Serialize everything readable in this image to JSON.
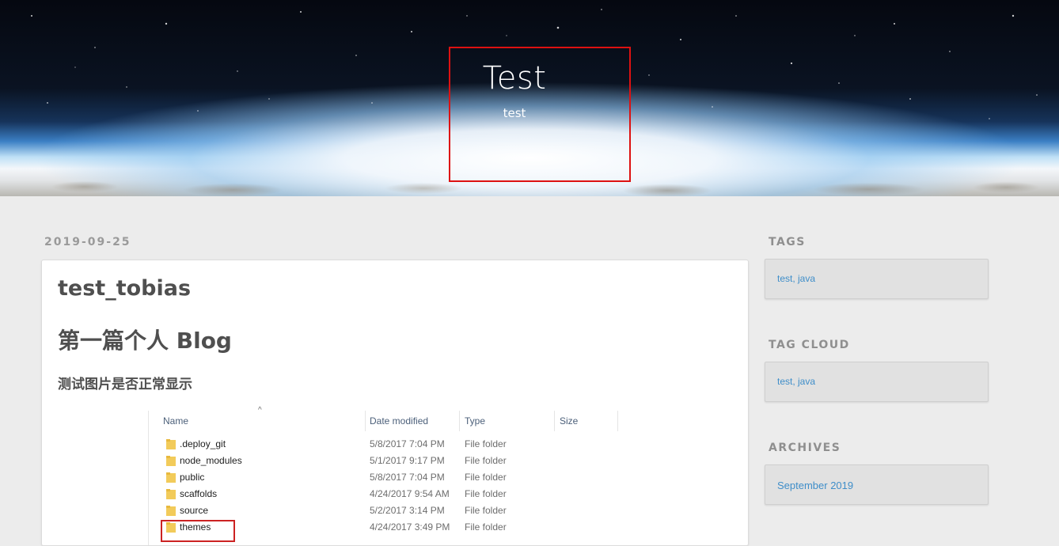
{
  "header": {
    "title": "Test",
    "subtitle": "test"
  },
  "post": {
    "date": "2019-09-25",
    "title": "test_tobias",
    "heading": "第一篇个人 Blog",
    "subheading": "测试图片是否正常显示",
    "image": {
      "columns": [
        "Name",
        "Date modified",
        "Type",
        "Size"
      ],
      "rows": [
        {
          "name": ".deploy_git",
          "date": "5/8/2017 7:04 PM",
          "type": "File folder"
        },
        {
          "name": "node_modules",
          "date": "5/1/2017 9:17 PM",
          "type": "File folder"
        },
        {
          "name": "public",
          "date": "5/8/2017 7:04 PM",
          "type": "File folder"
        },
        {
          "name": "scaffolds",
          "date": "4/24/2017 9:54 AM",
          "type": "File folder"
        },
        {
          "name": "source",
          "date": "5/2/2017 3:14 PM",
          "type": "File folder"
        },
        {
          "name": "themes",
          "date": "4/24/2017 3:49 PM",
          "type": "File folder"
        }
      ]
    }
  },
  "sidebar": {
    "tags": {
      "heading": "TAGS",
      "link": "test, java"
    },
    "tag_cloud": {
      "heading": "TAG CLOUD",
      "link": "test, java"
    },
    "archives": {
      "heading": "ARCHIVES",
      "link": "September 2019"
    }
  },
  "colors": {
    "link": "#3f8ec9",
    "highlight_border": "#d11111",
    "page_bg": "#ececec"
  }
}
